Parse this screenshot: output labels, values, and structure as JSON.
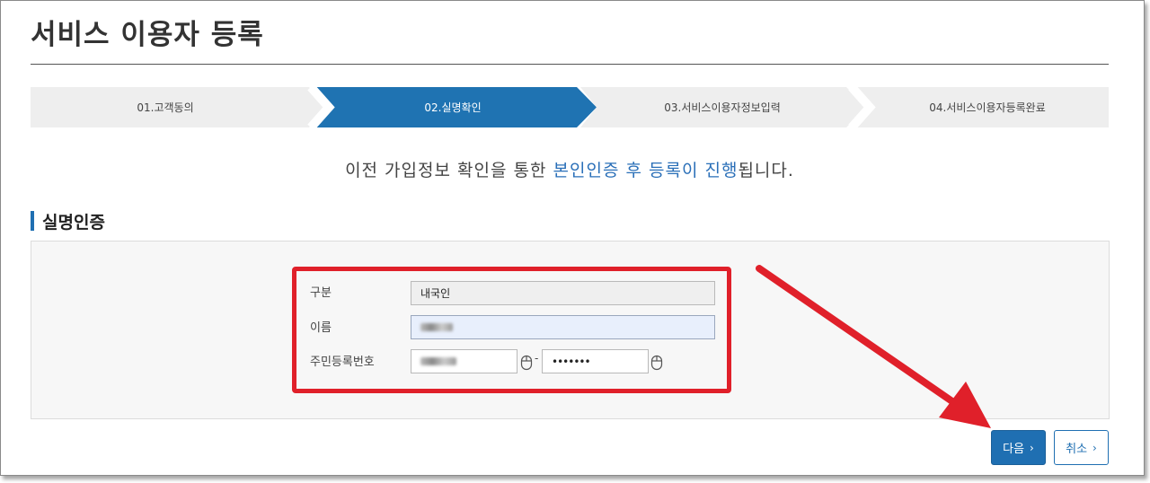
{
  "page": {
    "title": "서비스 이용자 등록"
  },
  "steps": [
    {
      "label": "01.고객동의",
      "active": false
    },
    {
      "label": "02.실명확인",
      "active": true
    },
    {
      "label": "03.서비스이용자정보입력",
      "active": false
    },
    {
      "label": "04.서비스이용자등록완료",
      "active": false
    }
  ],
  "intro": {
    "part1": "이전 가입정보 확인을 통한 ",
    "highlight": "본인인증 후 등록이 진행",
    "part2": "됩니다."
  },
  "section": {
    "title": "실명인증"
  },
  "form": {
    "type_label": "구분",
    "type_value": "내국인",
    "name_label": "이름",
    "rrn_label": "주민등록번호",
    "rrn_separator": "-",
    "rrn_back_value": "•••••••"
  },
  "buttons": {
    "next_label": "다음",
    "cancel_label": "취소"
  },
  "colors": {
    "accent": "#1f6fb2",
    "step_inactive": "#eeeeee",
    "highlight_box": "#e0202a"
  },
  "icons": {
    "mouse": "mouse-icon",
    "chevron": "chevron-right-icon"
  }
}
